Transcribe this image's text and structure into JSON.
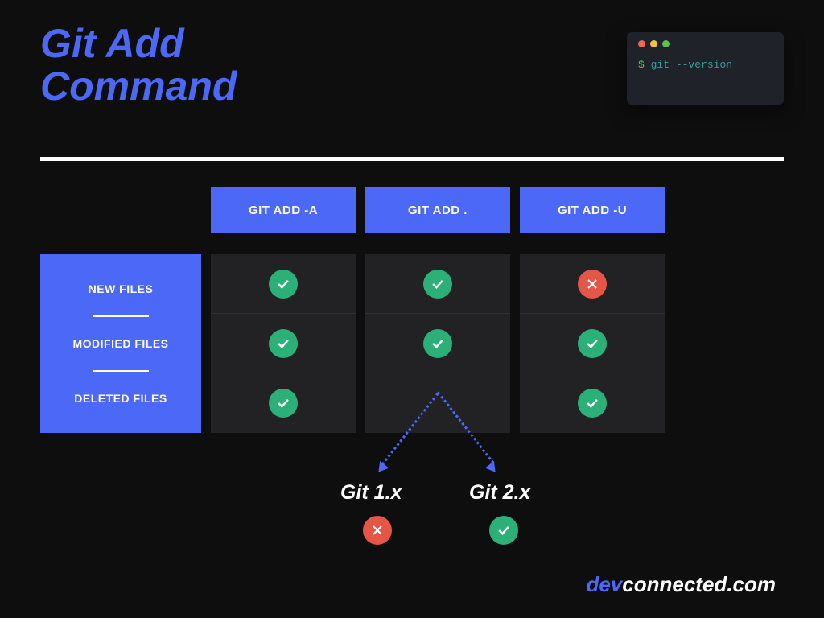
{
  "title_line1": "Git Add",
  "title_line2": "Command",
  "terminal": {
    "prompt": "$",
    "cmd": "git --version"
  },
  "columns": [
    "GIT ADD -A",
    "GIT ADD .",
    "GIT ADD -U"
  ],
  "rows": [
    "NEW FILES",
    "MODIFIED FILES",
    "DELETED FILES"
  ],
  "matrix": [
    [
      "ok",
      "ok",
      "no"
    ],
    [
      "ok",
      "ok",
      "ok"
    ],
    [
      "ok",
      "split",
      "ok"
    ]
  ],
  "split_versions": {
    "git1": {
      "label": "Git 1.x",
      "status": "no"
    },
    "git2": {
      "label": "Git 2.x",
      "status": "ok"
    }
  },
  "footer": {
    "brand": "dev",
    "rest": "connected.com"
  },
  "chart_data": {
    "type": "table",
    "title": "Git Add Command",
    "columns": [
      "GIT ADD -A",
      "GIT ADD .",
      "GIT ADD -U"
    ],
    "rows": [
      "NEW FILES",
      "MODIFIED FILES",
      "DELETED FILES"
    ],
    "values": [
      [
        true,
        true,
        false
      ],
      [
        true,
        true,
        true
      ],
      [
        true,
        {
          "Git 1.x": false,
          "Git 2.x": true
        },
        true
      ]
    ]
  }
}
